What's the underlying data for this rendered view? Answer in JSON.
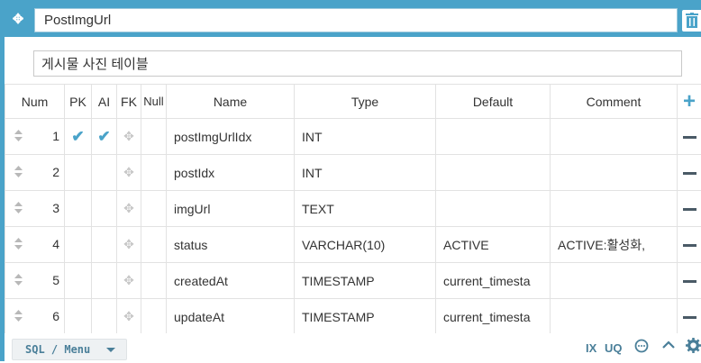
{
  "table": {
    "name": "PostImgUrl",
    "comment": "게시물 사진 테이블"
  },
  "columns_header": [
    "Num",
    "PK",
    "AI",
    "FK",
    "Null",
    "Name",
    "Type",
    "Default",
    "Comment"
  ],
  "rows": [
    {
      "num": "1",
      "pk": true,
      "ai": true,
      "name": "postImgUrlIdx",
      "type": "INT",
      "default": "",
      "comment": ""
    },
    {
      "num": "2",
      "pk": false,
      "ai": false,
      "name": "postIdx",
      "type": "INT",
      "default": "",
      "comment": ""
    },
    {
      "num": "3",
      "pk": false,
      "ai": false,
      "name": "imgUrl",
      "type": "TEXT",
      "default": "",
      "comment": ""
    },
    {
      "num": "4",
      "pk": false,
      "ai": false,
      "name": "status",
      "type": "VARCHAR(10)",
      "default": "ACTIVE",
      "comment": "ACTIVE:활성화,"
    },
    {
      "num": "5",
      "pk": false,
      "ai": false,
      "name": "createdAt",
      "type": "TIMESTAMP",
      "default": "current_timesta",
      "comment": ""
    },
    {
      "num": "6",
      "pk": false,
      "ai": false,
      "name": "updateAt",
      "type": "TIMESTAMP",
      "default": "current_timesta",
      "comment": ""
    }
  ],
  "footer": {
    "sql_menu_label": "SQL / Menu",
    "ix_label": "IX",
    "uq_label": "UQ"
  },
  "colors": {
    "accent": "#4aa3c9",
    "minus": "#4a5a66"
  },
  "icons": {
    "move": "move-icon",
    "trash": "trash-icon",
    "add": "plus-icon",
    "remove": "minus-icon",
    "sort": "sort-icon",
    "fk": "drag-icon",
    "check": "check-icon",
    "comment": "comment-icon",
    "collapse": "chevron-up-icon",
    "settings": "gear-icon"
  }
}
